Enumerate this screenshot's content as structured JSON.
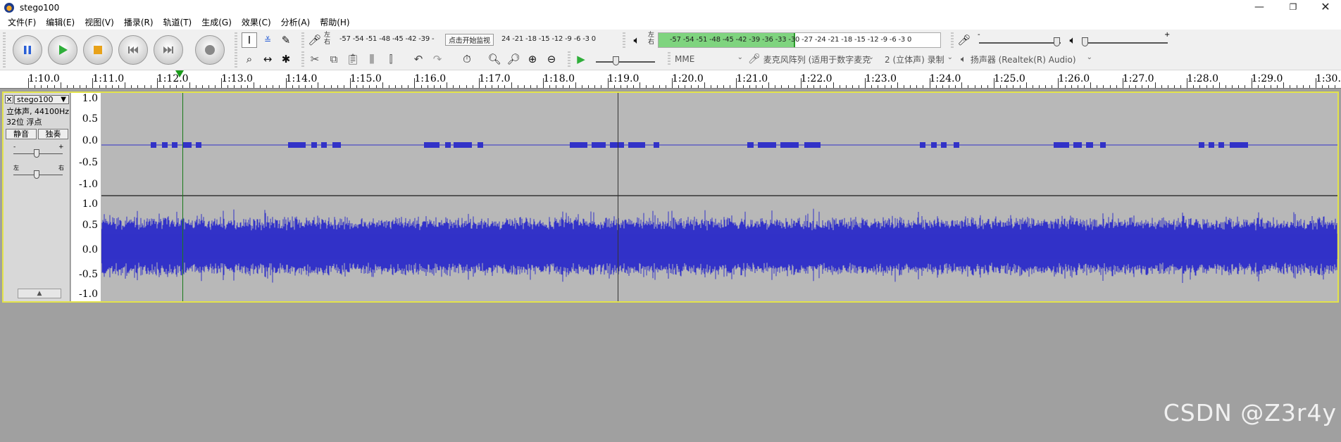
{
  "window": {
    "title": "stego100"
  },
  "menu": [
    "文件(F)",
    "编辑(E)",
    "视图(V)",
    "播录(R)",
    "轨道(T)",
    "生成(G)",
    "效果(C)",
    "分析(A)",
    "帮助(H)"
  ],
  "record_meter": {
    "channels_label": [
      "左",
      "右"
    ],
    "scale": "-57 -54 -51 -48 -45 -42 -39 -",
    "scale_tail": "24 -21 -18 -15 -12  -9  -6  -3  0",
    "prompt": "点击开始监视"
  },
  "play_meter": {
    "channels_label": [
      "左",
      "右"
    ],
    "scale": "-57 -54 -51 -48 -45 -42 -39 -36 -33 -30 -27 -24 -21 -18 -15 -12  -9  -6  -3  0",
    "level_fraction": 0.48
  },
  "devices": {
    "host": "MME",
    "input_device": "麦克风阵列 (适用于数字麦克",
    "input_channels": "2 (立体声) 录制",
    "output_device": "扬声器 (Realtek(R) Audio)"
  },
  "timeline": {
    "labels": [
      "1:10.0",
      "1:11.0",
      "1:12.0",
      "1:13.0",
      "1:14.0",
      "1:15.0",
      "1:16.0",
      "1:17.0",
      "1:18.0",
      "1:19.0",
      "1:20.0",
      "1:21.0",
      "1:22.0",
      "1:23.0",
      "1:24.0",
      "1:25.0",
      "1:26.0",
      "1:27.0",
      "1:28.0",
      "1:29.0",
      "1:30.0"
    ]
  },
  "track": {
    "name": "stego100",
    "info_line1": "立体声, 44100Hz",
    "info_line2": "32位 浮点",
    "mute_label": "静音",
    "solo_label": "独奏",
    "gain_minus": "-",
    "gain_plus": "+",
    "pan_left": "左",
    "pan_right": "右",
    "vruler_labels": [
      "1.0",
      "0.5",
      "0.0",
      "-0.5",
      "-1.0"
    ]
  },
  "colors": {
    "waveform": "#3232c8",
    "cursor": "#1a7a1a",
    "selection_border": "#e3e34a"
  },
  "watermark": "CSDN @Z3r4y"
}
